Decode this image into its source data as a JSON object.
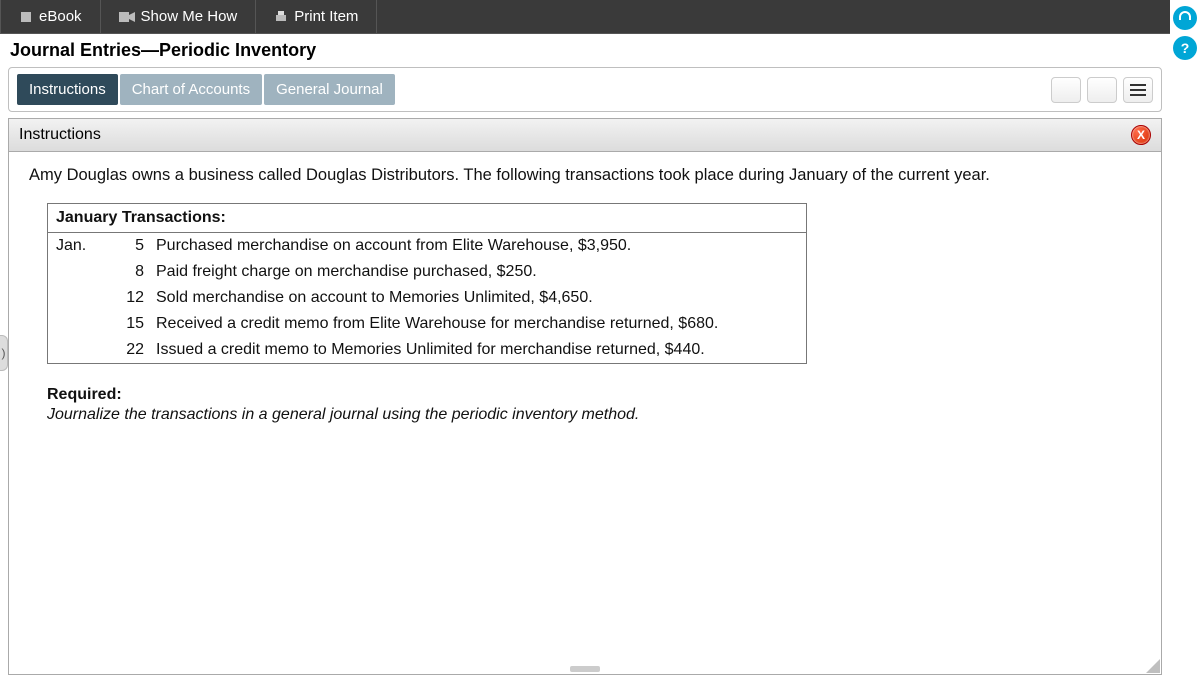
{
  "topbar": {
    "ebook_label": "eBook",
    "show_label": "Show Me How",
    "print_label": "Print Item"
  },
  "page_title": "Journal Entries—Periodic Inventory",
  "tabs": {
    "instructions": "Instructions",
    "chart": "Chart of Accounts",
    "journal": "General Journal"
  },
  "panel": {
    "header": "Instructions",
    "intro": "Amy Douglas owns a business called Douglas Distributors. The following transactions took place during January of the current year.",
    "trans_header": "January Transactions:",
    "month": "Jan.",
    "rows": [
      {
        "day": "5",
        "desc": "Purchased merchandise on account from Elite Warehouse, $3,950."
      },
      {
        "day": "8",
        "desc": "Paid freight charge on merchandise purchased, $250."
      },
      {
        "day": "12",
        "desc": "Sold merchandise on account to Memories Unlimited, $4,650."
      },
      {
        "day": "15",
        "desc": "Received a credit memo from Elite Warehouse for merchandise returned, $680."
      },
      {
        "day": "22",
        "desc": "Issued a credit memo to Memories Unlimited for merchandise returned, $440."
      }
    ],
    "required_label": "Required:",
    "required_text": "Journalize the transactions in a general journal using the periodic inventory method."
  }
}
